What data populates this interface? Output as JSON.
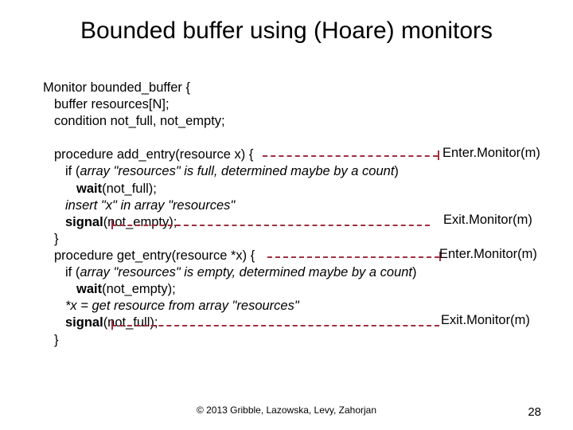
{
  "title": "Bounded buffer using (Hoare) monitors",
  "code": {
    "l0": "Monitor bounded_buffer {",
    "l1": "buffer resources[N];",
    "l2": "condition not_full, not_empty;",
    "l3": "procedure add_entry(resource x) {",
    "l4a": "if (",
    "l4b": "array \"resources\" is full, determined maybe by a count",
    "l4c": ")",
    "l5a": "wait",
    "l5b": "(not_full);",
    "l6": "insert \"x\" in array \"resources\"",
    "l7a": "signal",
    "l7b": "(not_empty);",
    "l8": "}",
    "l9": "procedure get_entry(resource *x) {",
    "l10a": "if (",
    "l10b": "array \"resources\" is empty, determined maybe by a count",
    "l10c": ")",
    "l11a": "wait",
    "l11b": "(not_empty);",
    "l12": "*x = get resource from array \"resources\"",
    "l13a": "signal",
    "l13b": "(not_full);",
    "l14": "}"
  },
  "annotations": {
    "enter1": "Enter.Monitor(m)",
    "exit1": "Exit.Monitor(m)",
    "enter2": "Enter.Monitor(m)",
    "exit2": "Exit.Monitor(m)"
  },
  "footer": "© 2013 Gribble, Lazowska, Levy, Zahorjan",
  "pagenum": "28"
}
